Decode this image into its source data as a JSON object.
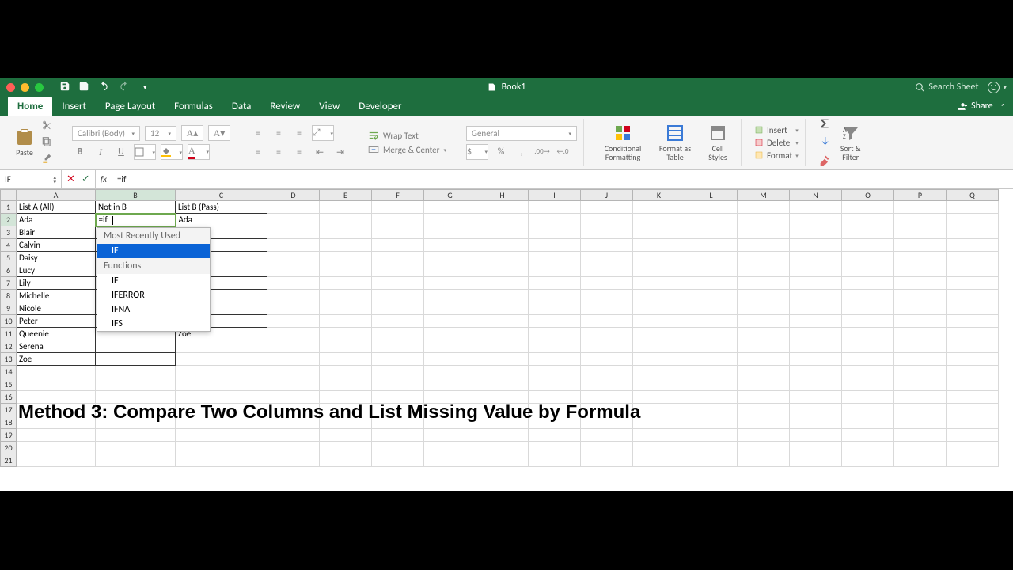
{
  "titlebar": {
    "doc": "Book1",
    "search_placeholder": "Search Sheet"
  },
  "tabs": {
    "items": [
      "Home",
      "Insert",
      "Page Layout",
      "Formulas",
      "Data",
      "Review",
      "View",
      "Developer"
    ],
    "share": "Share"
  },
  "ribbon": {
    "paste": "Paste",
    "font": "Calibri (Body)",
    "size": "12",
    "wrap": "Wrap Text",
    "merge": "Merge & Center",
    "numfmt": "General",
    "cond_fmt": "Conditional Formatting",
    "fmt_table": "Format as Table",
    "cell_styles": "Cell Styles",
    "insert": "Insert",
    "delete": "Delete",
    "format": "Format",
    "sort": "Sort & Filter"
  },
  "formula_bar": {
    "namebox": "IF",
    "fx": "fx",
    "input": "=if"
  },
  "columns": [
    "A",
    "B",
    "C",
    "D",
    "E",
    "F",
    "G",
    "H",
    "I",
    "J",
    "K",
    "L",
    "M",
    "N",
    "O",
    "P",
    "Q"
  ],
  "headers": {
    "A": "List A (All)",
    "B": "Not in B",
    "C": "List B (Pass)"
  },
  "listA": [
    "Ada",
    "Blair",
    "Calvin",
    "Daisy",
    "Lucy",
    "Lily",
    "Michelle",
    "Nicole",
    "Peter",
    "Queenie",
    "Serena",
    "Zoe"
  ],
  "listC": [
    "Ada",
    "",
    "",
    "",
    "",
    "",
    "",
    "",
    "",
    "Zoe"
  ],
  "editing": "=if",
  "ac": {
    "mru_header": "Most Recently Used",
    "mru_items": [
      "IF"
    ],
    "fn_header": "Functions",
    "fn_items": [
      "IF",
      "IFERROR",
      "IFNA",
      "IFS"
    ]
  },
  "overlay": "Method 3: Compare Two Columns and List Missing Value by Formula"
}
